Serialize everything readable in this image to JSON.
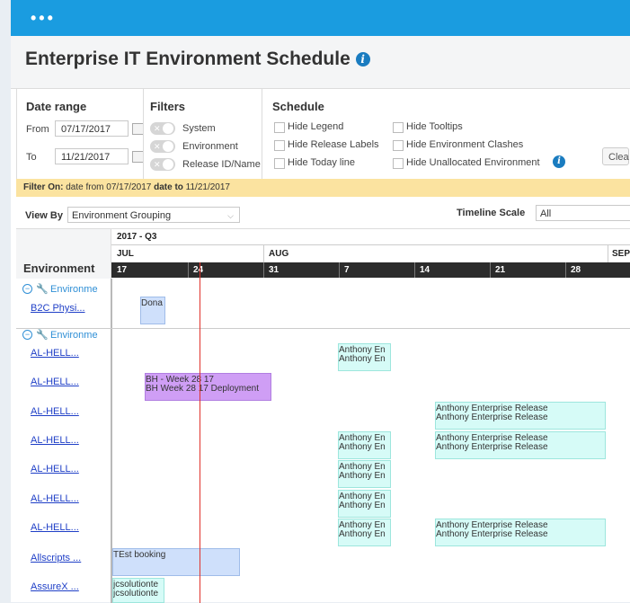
{
  "app": {
    "title": "Enterprise IT Environment Schedule",
    "topbar_dots": "•••",
    "info_glyph": "i"
  },
  "date_range": {
    "title": "Date range",
    "from_label": "From",
    "from_value": "07/17/2017",
    "to_label": "To",
    "to_value": "11/21/2017"
  },
  "filters": {
    "title": "Filters",
    "items": [
      "System",
      "Environment",
      "Release ID/Name"
    ]
  },
  "schedule": {
    "title": "Schedule",
    "options": [
      "Hide Legend",
      "Hide Release Labels",
      "Hide Today line",
      "Hide Tooltips",
      "Hide Environment Clashes",
      "Hide Unallocated Environment"
    ],
    "clear_label": "Clea"
  },
  "filter_on": {
    "prefix": "Filter On:",
    "middle1": " date from ",
    "from": "07/17/2017",
    "middle2": " date to ",
    "to": "11/21/2017"
  },
  "view_by": {
    "label": "View By",
    "value": "Environment Grouping",
    "scale_label": "Timeline Scale",
    "scale_value": "All"
  },
  "timeline": {
    "env_header": "Environment",
    "quarter": "2017 - Q3",
    "months": [
      "JUL",
      "AUG",
      "SEP"
    ],
    "weeks": [
      "17",
      "24",
      "31",
      "7",
      "14",
      "21",
      "28"
    ]
  },
  "groups": [
    {
      "label": "Environme",
      "rows": [
        "B2C Physi..."
      ]
    },
    {
      "label": "Environme",
      "rows": [
        "AL-HELL...",
        "AL-HELL...",
        "AL-HELL...",
        "AL-HELL...",
        "AL-HELL...",
        "AL-HELL...",
        "AL-HELL...",
        "Allscripts ...",
        "AssureX ..."
      ]
    }
  ],
  "bookings": {
    "dona": "Dona",
    "anthony_short": "Anthony En",
    "anthony_long": "Anthony Enterprise Release",
    "bh1": "BH - Week 28 17",
    "bh2": "BH Week 28 17 Deployment",
    "test": "TEst booking",
    "jcs": "jcsolutionte"
  }
}
